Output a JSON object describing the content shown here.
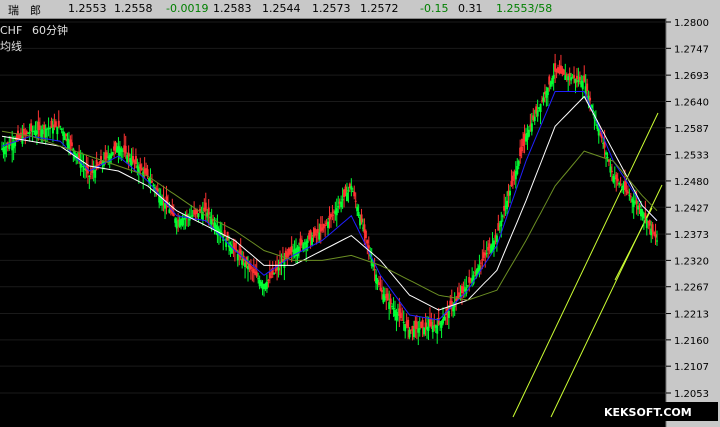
{
  "quote_bar": {
    "symbol": "瑞　郎",
    "fields": [
      {
        "text": "1.2553",
        "color": "#000000"
      },
      {
        "text": "1.2558",
        "color": "#000000"
      },
      {
        "text": "-0.0019",
        "color": "#008000"
      },
      {
        "text": "1.2583",
        "color": "#000000"
      },
      {
        "text": "1.2544",
        "color": "#000000"
      },
      {
        "text": "1.2573",
        "color": "#000000"
      },
      {
        "text": "1.2572",
        "color": "#000000"
      },
      {
        "text": "-0.15",
        "color": "#008000"
      },
      {
        "text": "0.31",
        "color": "#000000"
      },
      {
        "text": "1.2553/58",
        "color": "#008000"
      }
    ]
  },
  "chart_header": {
    "symbol": "CHF",
    "period": "60分钟",
    "sub": "均线"
  },
  "watermark": "KEKSOFT.COM",
  "chart_data": {
    "type": "line",
    "ylim": [
      1.2,
      1.28
    ],
    "y_ticks": [
      "1.2800",
      "1.2747",
      "1.2693",
      "1.2640",
      "1.2587",
      "1.2533",
      "1.2480",
      "1.2427",
      "1.2373",
      "1.2320",
      "1.2267",
      "1.2213",
      "1.2160",
      "1.2107",
      "1.2053"
    ],
    "x_index": [
      0,
      10,
      20,
      30,
      40,
      50,
      60,
      70,
      80,
      90,
      100,
      110,
      120,
      130,
      140,
      150,
      160,
      170,
      180,
      190,
      200,
      210,
      220,
      225
    ],
    "series": [
      {
        "role": "price",
        "color": "#00c000",
        "values": [
          1.2545,
          1.258,
          1.259,
          1.249,
          1.255,
          1.249,
          1.24,
          1.242,
          1.234,
          1.227,
          1.234,
          1.238,
          1.247,
          1.226,
          1.218,
          1.219,
          1.227,
          1.237,
          1.257,
          1.27,
          1.268,
          1.249,
          1.242,
          1.236
        ]
      },
      {
        "role": "ma1",
        "color": "#2020ff",
        "values": [
          1.255,
          1.257,
          1.256,
          1.25,
          1.253,
          1.248,
          1.241,
          1.24,
          1.234,
          1.229,
          1.233,
          1.236,
          1.241,
          1.229,
          1.221,
          1.22,
          1.226,
          1.235,
          1.252,
          1.266,
          1.266,
          1.252,
          1.243,
          1.24
        ]
      },
      {
        "role": "ma2",
        "color": "#ffffff",
        "values": [
          1.257,
          1.256,
          1.255,
          1.251,
          1.25,
          1.247,
          1.242,
          1.239,
          1.236,
          1.231,
          1.231,
          1.234,
          1.237,
          1.232,
          1.225,
          1.222,
          1.224,
          1.23,
          1.244,
          1.259,
          1.265,
          1.254,
          1.243,
          1.24
        ]
      },
      {
        "role": "ma3",
        "color": "#6b8e23",
        "values": [
          1.258,
          1.257,
          1.255,
          1.253,
          1.251,
          1.249,
          1.245,
          1.241,
          1.238,
          1.234,
          1.232,
          1.232,
          1.233,
          1.231,
          1.228,
          1.225,
          1.224,
          1.226,
          1.236,
          1.247,
          1.254,
          1.252,
          1.245,
          1.242
        ]
      }
    ]
  }
}
